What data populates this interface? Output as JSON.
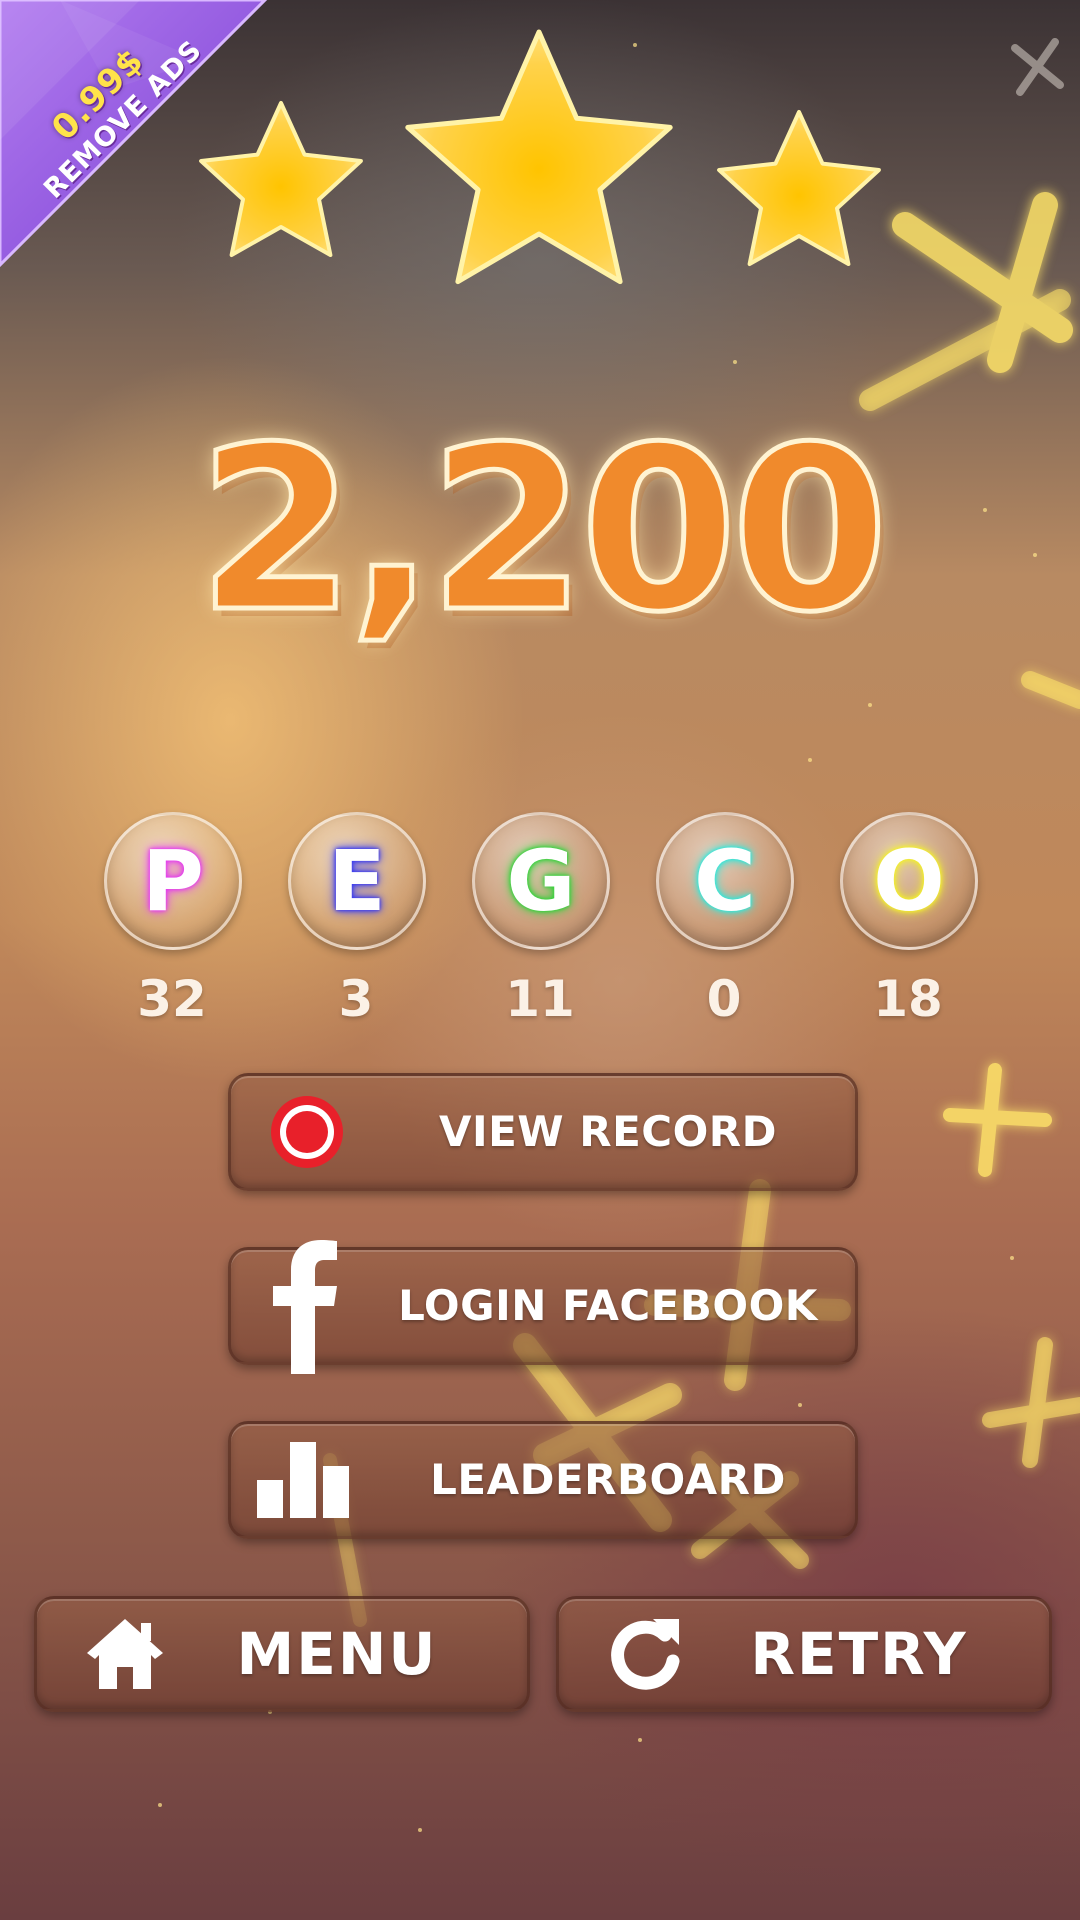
{
  "promo": {
    "price": "0.99$",
    "label": "REMOVE ADS",
    "color": "#8c4fe0"
  },
  "rating": {
    "stars_earned": 3,
    "stars_total": 3,
    "star_color": "#ffc72a"
  },
  "score": {
    "value": "2,200",
    "color": "#f08a2c"
  },
  "letters": [
    {
      "letter": "P",
      "count": "32",
      "color": "#e43cf0"
    },
    {
      "letter": "E",
      "count": "3",
      "color": "#3a3cf0"
    },
    {
      "letter": "G",
      "count": "11",
      "color": "#34d23c"
    },
    {
      "letter": "C",
      "count": "0",
      "color": "#30e8dc"
    },
    {
      "letter": "O",
      "count": "18",
      "color": "#f2f02c"
    }
  ],
  "buttons": {
    "view_record": {
      "label": "VIEW RECORD",
      "icon": "record-icon"
    },
    "login_facebook": {
      "label": "LOGIN FACEBOOK",
      "icon": "facebook-icon"
    },
    "leaderboard": {
      "label": "LEADERBOARD",
      "icon": "leaderboard-icon"
    },
    "menu": {
      "label": "MENU",
      "icon": "home-icon"
    },
    "retry": {
      "label": "RETRY",
      "icon": "retry-icon"
    }
  },
  "colors": {
    "accent_red": "#e8202a",
    "text": "#ffffff"
  }
}
